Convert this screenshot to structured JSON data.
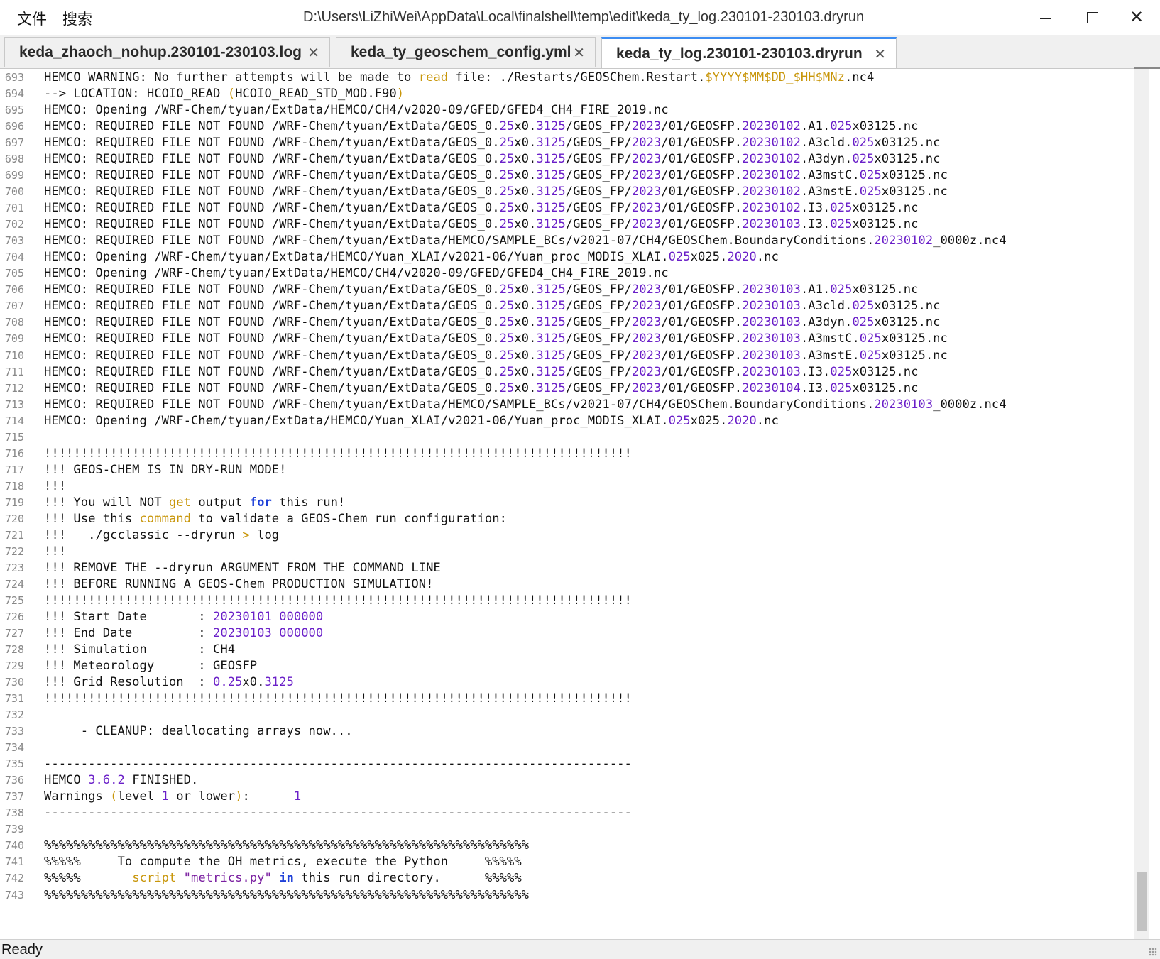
{
  "menu": {
    "file": "文件",
    "search": "搜索"
  },
  "window": {
    "title": "D:\\Users\\LiZhiWei\\AppData\\Local\\finalshell\\temp\\edit\\keda_ty_log.230101-230103.dryrun"
  },
  "tabs": [
    {
      "label": "keda_zhaoch_nohup.230101-230103.log",
      "active": false
    },
    {
      "label": "keda_ty_geoschem_config.yml",
      "active": false
    },
    {
      "label": "keda_ty_log.230101-230103.dryrun",
      "active": true
    }
  ],
  "lines": [
    {
      "n": "693",
      "t": "HEMCO WARNING: No further attempts will be made to [[kw:read]] file: ./Restarts/GEOSChem.Restart.[[kw:$YYYY$MM$DD_$HH$MNz]].nc4"
    },
    {
      "n": "694",
      "t": "--> LOCATION: HCOIO_READ [[kw:(]]HCOIO_READ_STD_MOD.F90[[kw:)]]"
    },
    {
      "n": "695",
      "t": "HEMCO: Opening /WRF-Chem/tyuan/ExtData/HEMCO/CH4/v2020-09/GFED/GFED4_CH4_FIRE_2019.nc"
    },
    {
      "n": "696",
      "t": "HEMCO: REQUIRED FILE NOT FOUND /WRF-Chem/tyuan/ExtData/GEOS_0.[[num:25]]x0.[[num:3125]]/GEOS_FP/[[num:2023]]/01/GEOSFP.[[num:20230102]].A1.[[num:025]]x03125.nc"
    },
    {
      "n": "697",
      "t": "HEMCO: REQUIRED FILE NOT FOUND /WRF-Chem/tyuan/ExtData/GEOS_0.[[num:25]]x0.[[num:3125]]/GEOS_FP/[[num:2023]]/01/GEOSFP.[[num:20230102]].A3cld.[[num:025]]x03125.nc"
    },
    {
      "n": "698",
      "t": "HEMCO: REQUIRED FILE NOT FOUND /WRF-Chem/tyuan/ExtData/GEOS_0.[[num:25]]x0.[[num:3125]]/GEOS_FP/[[num:2023]]/01/GEOSFP.[[num:20230102]].A3dyn.[[num:025]]x03125.nc"
    },
    {
      "n": "699",
      "t": "HEMCO: REQUIRED FILE NOT FOUND /WRF-Chem/tyuan/ExtData/GEOS_0.[[num:25]]x0.[[num:3125]]/GEOS_FP/[[num:2023]]/01/GEOSFP.[[num:20230102]].A3mstC.[[num:025]]x03125.nc"
    },
    {
      "n": "700",
      "t": "HEMCO: REQUIRED FILE NOT FOUND /WRF-Chem/tyuan/ExtData/GEOS_0.[[num:25]]x0.[[num:3125]]/GEOS_FP/[[num:2023]]/01/GEOSFP.[[num:20230102]].A3mstE.[[num:025]]x03125.nc"
    },
    {
      "n": "701",
      "t": "HEMCO: REQUIRED FILE NOT FOUND /WRF-Chem/tyuan/ExtData/GEOS_0.[[num:25]]x0.[[num:3125]]/GEOS_FP/[[num:2023]]/01/GEOSFP.[[num:20230102]].I3.[[num:025]]x03125.nc"
    },
    {
      "n": "702",
      "t": "HEMCO: REQUIRED FILE NOT FOUND /WRF-Chem/tyuan/ExtData/GEOS_0.[[num:25]]x0.[[num:3125]]/GEOS_FP/[[num:2023]]/01/GEOSFP.[[num:20230103]].I3.[[num:025]]x03125.nc"
    },
    {
      "n": "703",
      "t": "HEMCO: REQUIRED FILE NOT FOUND /WRF-Chem/tyuan/ExtData/HEMCO/SAMPLE_BCs/v2021-07/CH4/GEOSChem.BoundaryConditions.[[num:20230102]]_0000z.nc4"
    },
    {
      "n": "704",
      "t": "HEMCO: Opening /WRF-Chem/tyuan/ExtData/HEMCO/Yuan_XLAI/v2021-06/Yuan_proc_MODIS_XLAI.[[num:025]]x025.[[num:2020]].nc"
    },
    {
      "n": "705",
      "t": "HEMCO: Opening /WRF-Chem/tyuan/ExtData/HEMCO/CH4/v2020-09/GFED/GFED4_CH4_FIRE_2019.nc"
    },
    {
      "n": "706",
      "t": "HEMCO: REQUIRED FILE NOT FOUND /WRF-Chem/tyuan/ExtData/GEOS_0.[[num:25]]x0.[[num:3125]]/GEOS_FP/[[num:2023]]/01/GEOSFP.[[num:20230103]].A1.[[num:025]]x03125.nc"
    },
    {
      "n": "707",
      "t": "HEMCO: REQUIRED FILE NOT FOUND /WRF-Chem/tyuan/ExtData/GEOS_0.[[num:25]]x0.[[num:3125]]/GEOS_FP/[[num:2023]]/01/GEOSFP.[[num:20230103]].A3cld.[[num:025]]x03125.nc"
    },
    {
      "n": "708",
      "t": "HEMCO: REQUIRED FILE NOT FOUND /WRF-Chem/tyuan/ExtData/GEOS_0.[[num:25]]x0.[[num:3125]]/GEOS_FP/[[num:2023]]/01/GEOSFP.[[num:20230103]].A3dyn.[[num:025]]x03125.nc"
    },
    {
      "n": "709",
      "t": "HEMCO: REQUIRED FILE NOT FOUND /WRF-Chem/tyuan/ExtData/GEOS_0.[[num:25]]x0.[[num:3125]]/GEOS_FP/[[num:2023]]/01/GEOSFP.[[num:20230103]].A3mstC.[[num:025]]x03125.nc"
    },
    {
      "n": "710",
      "t": "HEMCO: REQUIRED FILE NOT FOUND /WRF-Chem/tyuan/ExtData/GEOS_0.[[num:25]]x0.[[num:3125]]/GEOS_FP/[[num:2023]]/01/GEOSFP.[[num:20230103]].A3mstE.[[num:025]]x03125.nc"
    },
    {
      "n": "711",
      "t": "HEMCO: REQUIRED FILE NOT FOUND /WRF-Chem/tyuan/ExtData/GEOS_0.[[num:25]]x0.[[num:3125]]/GEOS_FP/[[num:2023]]/01/GEOSFP.[[num:20230103]].I3.[[num:025]]x03125.nc"
    },
    {
      "n": "712",
      "t": "HEMCO: REQUIRED FILE NOT FOUND /WRF-Chem/tyuan/ExtData/GEOS_0.[[num:25]]x0.[[num:3125]]/GEOS_FP/[[num:2023]]/01/GEOSFP.[[num:20230104]].I3.[[num:025]]x03125.nc"
    },
    {
      "n": "713",
      "t": "HEMCO: REQUIRED FILE NOT FOUND /WRF-Chem/tyuan/ExtData/HEMCO/SAMPLE_BCs/v2021-07/CH4/GEOSChem.BoundaryConditions.[[num:20230103]]_0000z.nc4"
    },
    {
      "n": "714",
      "t": "HEMCO: Opening /WRF-Chem/tyuan/ExtData/HEMCO/Yuan_XLAI/v2021-06/Yuan_proc_MODIS_XLAI.[[num:025]]x025.[[num:2020]].nc"
    },
    {
      "n": "715",
      "t": ""
    },
    {
      "n": "716",
      "t": "!!!!!!!!!!!!!!!!!!!!!!!!!!!!!!!!!!!!!!!!!!!!!!!!!!!!!!!!!!!!!!!!!!!!!!!!!!!!!!!!"
    },
    {
      "n": "717",
      "t": "!!! GEOS-CHEM IS IN DRY-RUN MODE!"
    },
    {
      "n": "718",
      "t": "!!!"
    },
    {
      "n": "719",
      "t": "!!! You will NOT [[kw:get]] output [[kb:for]] this run!"
    },
    {
      "n": "720",
      "t": "!!! Use this [[kw:command]] to validate a GEOS-Chem run configuration:"
    },
    {
      "n": "721",
      "t": "!!!   ./gcclassic --dryrun [[kw:>]] log"
    },
    {
      "n": "722",
      "t": "!!!"
    },
    {
      "n": "723",
      "t": "!!! REMOVE THE --dryrun ARGUMENT FROM THE COMMAND LINE"
    },
    {
      "n": "724",
      "t": "!!! BEFORE RUNNING A GEOS-Chem PRODUCTION SIMULATION!"
    },
    {
      "n": "725",
      "t": "!!!!!!!!!!!!!!!!!!!!!!!!!!!!!!!!!!!!!!!!!!!!!!!!!!!!!!!!!!!!!!!!!!!!!!!!!!!!!!!!"
    },
    {
      "n": "726",
      "t": "!!! Start Date       : [[num:20230101]] [[num:000000]]"
    },
    {
      "n": "727",
      "t": "!!! End Date         : [[num:20230103]] [[num:000000]]"
    },
    {
      "n": "728",
      "t": "!!! Simulation       : CH4"
    },
    {
      "n": "729",
      "t": "!!! Meteorology      : GEOSFP"
    },
    {
      "n": "730",
      "t": "!!! Grid Resolution  : [[num:0.25]]x0.[[num:3125]]"
    },
    {
      "n": "731",
      "t": "!!!!!!!!!!!!!!!!!!!!!!!!!!!!!!!!!!!!!!!!!!!!!!!!!!!!!!!!!!!!!!!!!!!!!!!!!!!!!!!!"
    },
    {
      "n": "732",
      "t": ""
    },
    {
      "n": "733",
      "t": "     - CLEANUP: deallocating arrays now..."
    },
    {
      "n": "734",
      "t": ""
    },
    {
      "n": "735",
      "t": "--------------------------------------------------------------------------------"
    },
    {
      "n": "736",
      "t": "HEMCO [[num:3.6.2]] FINISHED."
    },
    {
      "n": "737",
      "t": "Warnings [[kw:(]]level [[num:1]] or lower[[kw:)]]:      [[num:1]]"
    },
    {
      "n": "738",
      "t": "--------------------------------------------------------------------------------"
    },
    {
      "n": "739",
      "t": ""
    },
    {
      "n": "740",
      "t": "%%%%%%%%%%%%%%%%%%%%%%%%%%%%%%%%%%%%%%%%%%%%%%%%%%%%%%%%%%%%%%%%%%"
    },
    {
      "n": "741",
      "t": "%%%%%     To compute the OH metrics, execute the Python     %%%%%"
    },
    {
      "n": "742",
      "t": "%%%%%       [[kw:script]] [[str:\"metrics.py\"]] [[kb:in]] this run directory.      %%%%%"
    },
    {
      "n": "743",
      "t": "%%%%%%%%%%%%%%%%%%%%%%%%%%%%%%%%%%%%%%%%%%%%%%%%%%%%%%%%%%%%%%%%%%"
    }
  ],
  "status": {
    "text": "Ready"
  },
  "colors": {
    "accent": "#3c8df2",
    "number": "#6a1fc8",
    "keyword": "#c8960a",
    "keyword_blue": "#1e40d8",
    "string": "#7a1fa0"
  }
}
